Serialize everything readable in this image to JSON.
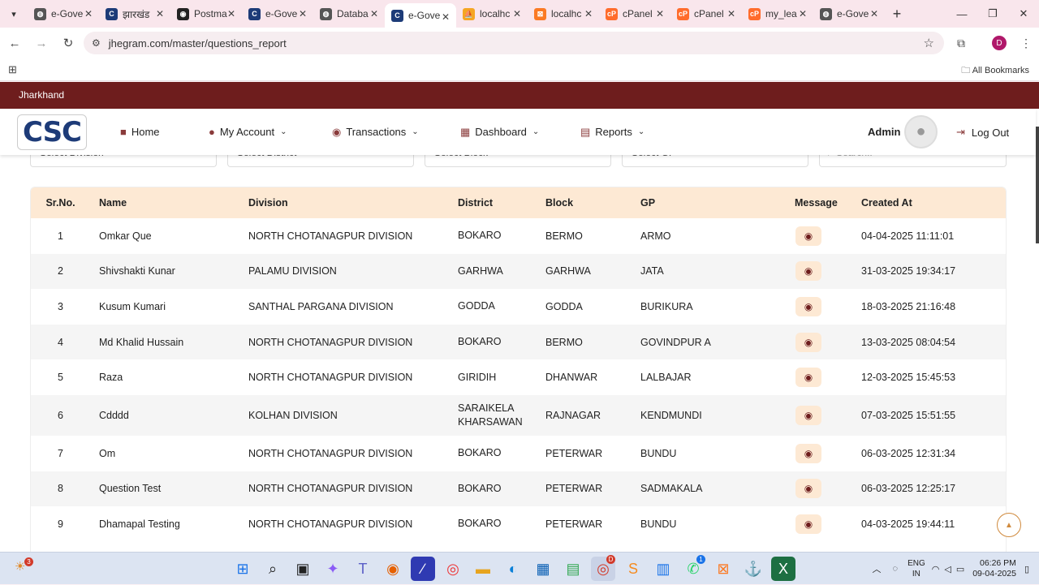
{
  "browser": {
    "tabs": [
      {
        "title": "e-Gove",
        "icon": "globe-icon",
        "active": false
      },
      {
        "title": "झारखंड",
        "icon": "csc-icon",
        "active": false
      },
      {
        "title": "Postma",
        "icon": "postman-icon",
        "active": false
      },
      {
        "title": "e-Gove",
        "icon": "csc-icon",
        "active": false
      },
      {
        "title": "Databa",
        "icon": "globe-icon",
        "active": false
      },
      {
        "title": "e-Gove",
        "icon": "csc-icon",
        "active": true
      },
      {
        "title": "localhc",
        "icon": "phpmyadmin-icon",
        "active": false
      },
      {
        "title": "localhc",
        "icon": "xampp-icon",
        "active": false
      },
      {
        "title": "cPanel",
        "icon": "cpanel-icon",
        "active": false
      },
      {
        "title": "cPanel",
        "icon": "cpanel-icon",
        "active": false
      },
      {
        "title": "my_lea",
        "icon": "cpanel-icon",
        "active": false
      },
      {
        "title": "e-Gove",
        "icon": "globe-icon",
        "active": false
      }
    ],
    "url": "jhegram.com/master/questions_report",
    "profile_initial": "D",
    "bookmarks_label": "All Bookmarks"
  },
  "site": {
    "state_label": "Jharkhand",
    "logo_text": "CSC",
    "nav": {
      "home": "Home",
      "my_account": "My Account",
      "transactions": "Transactions",
      "dashboard": "Dashboard",
      "reports": "Reports"
    },
    "admin_name": "Admin",
    "logout_label": "Log Out",
    "filters": {
      "division": "Select Division",
      "district": "Select District",
      "block": "Select Block",
      "gp": "Select GP",
      "search_placeholder": "Search.."
    },
    "table": {
      "headers": [
        "Sr.No.",
        "Name",
        "Division",
        "District",
        "Block",
        "GP",
        "Message",
        "Created At"
      ],
      "rows": [
        {
          "sr": "1",
          "name": "Omkar Que",
          "division": "NORTH CHOTANAGPUR DIVISION",
          "district": "BOKARO",
          "block": "BERMO",
          "gp": "ARMO",
          "created": "04-04-2025 11:11:01"
        },
        {
          "sr": "2",
          "name": "Shivshakti Kunar",
          "division": "PALAMU DIVISION",
          "district": "GARHWA",
          "block": "GARHWA",
          "gp": "JATA",
          "created": "31-03-2025 19:34:17"
        },
        {
          "sr": "3",
          "name": "Kusum Kumari",
          "division": "SANTHAL PARGANA DIVISION",
          "district": "GODDA",
          "block": "GODDA",
          "gp": "BURIKURA",
          "created": "18-03-2025 21:16:48"
        },
        {
          "sr": "4",
          "name": "Md Khalid Hussain",
          "division": "NORTH CHOTANAGPUR DIVISION",
          "district": "BOKARO",
          "block": "BERMO",
          "gp": "GOVINDPUR A",
          "created": "13-03-2025 08:04:54"
        },
        {
          "sr": "5",
          "name": "Raza",
          "division": "NORTH CHOTANAGPUR DIVISION",
          "district": "GIRIDIH",
          "block": "DHANWAR",
          "gp": "LALBAJAR",
          "created": "12-03-2025 15:45:53"
        },
        {
          "sr": "6",
          "name": "Cdddd",
          "division": "KOLHAN DIVISION",
          "district": "SARAIKELA KHARSAWAN",
          "block": "RAJNAGAR",
          "gp": "KENDMUNDI",
          "created": "07-03-2025 15:51:55"
        },
        {
          "sr": "7",
          "name": "Om",
          "division": "NORTH CHOTANAGPUR DIVISION",
          "district": "BOKARO",
          "block": "PETERWAR",
          "gp": "BUNDU",
          "created": "06-03-2025 12:31:34"
        },
        {
          "sr": "8",
          "name": "Question Test",
          "division": "NORTH CHOTANAGPUR DIVISION",
          "district": "BOKARO",
          "block": "PETERWAR",
          "gp": "SADMAKALA",
          "created": "06-03-2025 12:25:17"
        },
        {
          "sr": "9",
          "name": "Dhamapal Testing",
          "division": "NORTH CHOTANAGPUR DIVISION",
          "district": "BOKARO",
          "block": "PETERWAR",
          "gp": "BUNDU",
          "created": "04-03-2025 19:44:11"
        }
      ]
    }
  },
  "taskbar": {
    "weather_badge": "3",
    "chrome_badge": "D",
    "whatsapp_badge": "1",
    "lang_top": "ENG",
    "lang_bottom": "IN",
    "time": "06:26 PM",
    "date": "09-04-2025"
  },
  "colors": {
    "state_bar": "#6e1d1d",
    "table_header": "#fde9d4",
    "accent": "#d08a3d"
  }
}
